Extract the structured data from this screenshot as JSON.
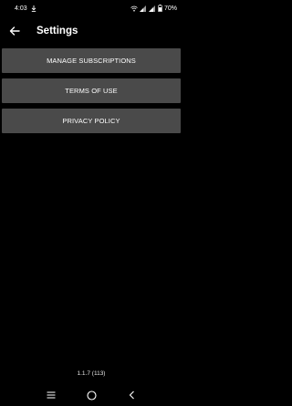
{
  "status_bar": {
    "time": "4:03",
    "battery": "70%"
  },
  "header": {
    "title": "Settings"
  },
  "menu": {
    "items": [
      {
        "label": "MANAGE SUBSCRIPTIONS"
      },
      {
        "label": "TERMS OF USE"
      },
      {
        "label": "PRIVACY POLICY"
      }
    ]
  },
  "version": "1.1.7 (113)",
  "colors": {
    "background": "#000000",
    "button": "#4a4a4a",
    "text": "#ffffff"
  },
  "icons": {
    "back": "arrow-left-icon",
    "download": "download-icon",
    "nav_recents": "recents-icon",
    "nav_home": "home-icon",
    "nav_back": "back-chevron-icon"
  }
}
